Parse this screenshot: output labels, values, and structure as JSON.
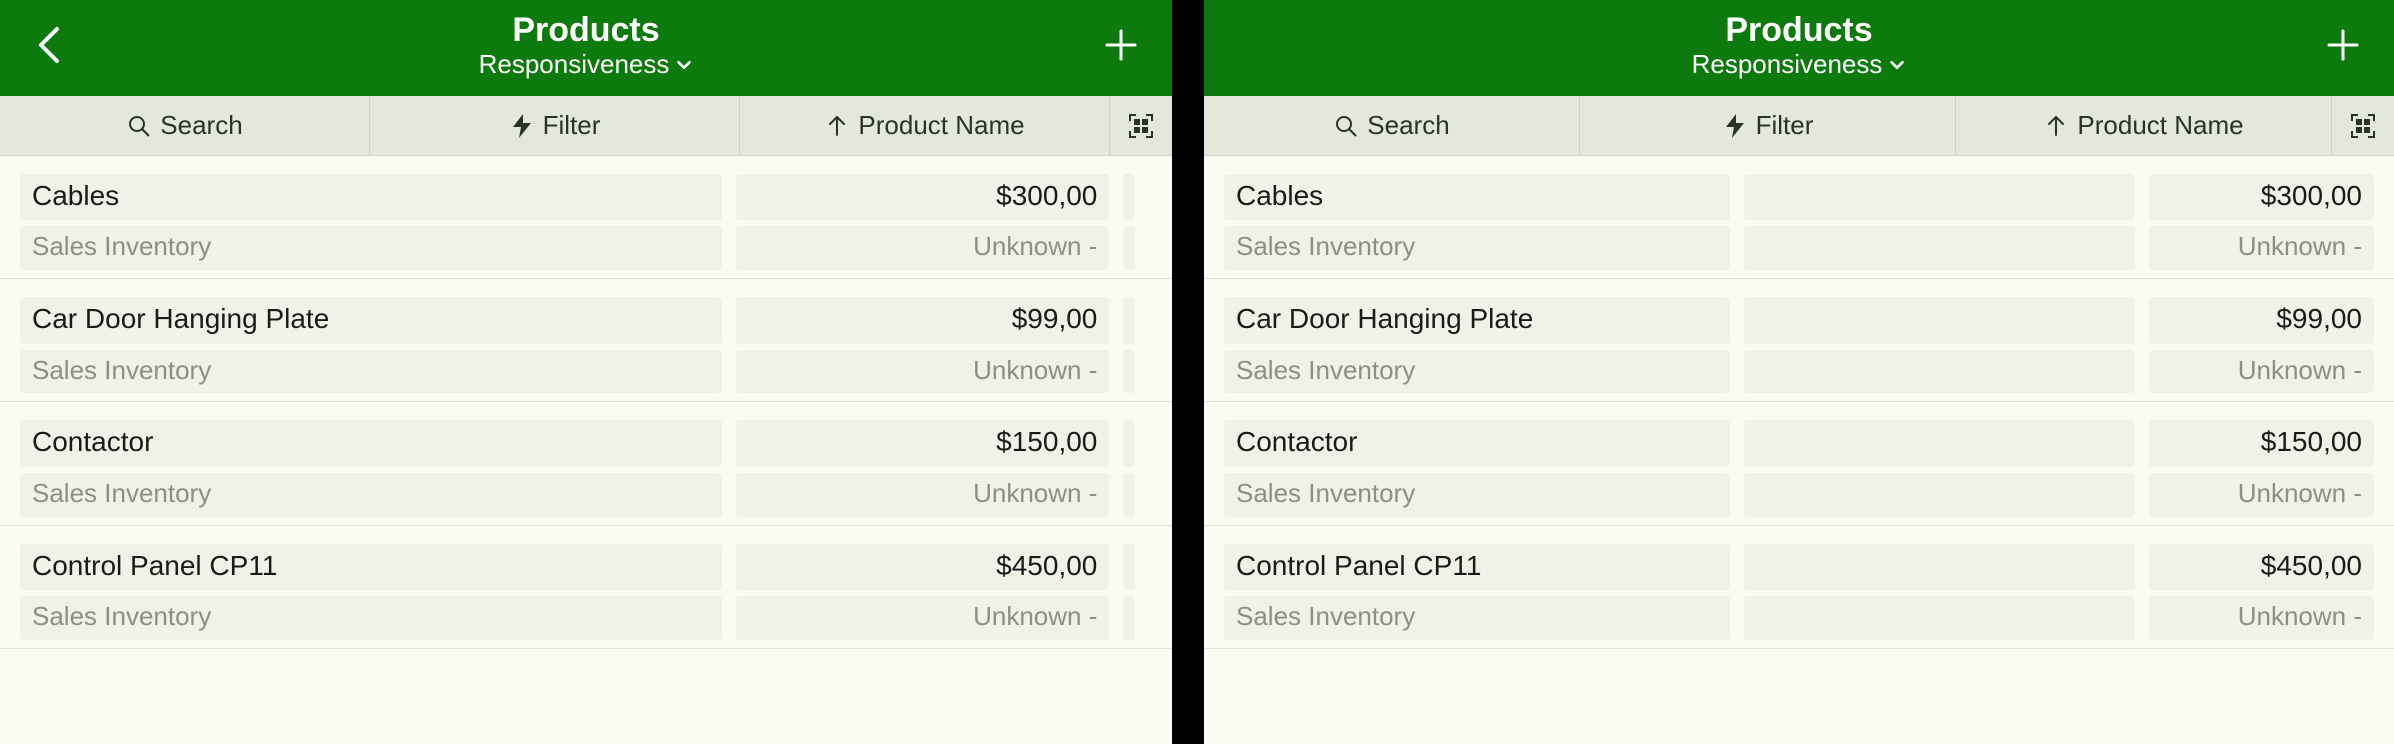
{
  "header": {
    "title": "Products",
    "subtitle": "Responsiveness"
  },
  "toolbar": {
    "search": "Search",
    "filter": "Filter",
    "sort": "Product Name"
  },
  "rows": [
    {
      "name": "Cables",
      "price": "$300,00",
      "group": "Sales Inventory",
      "status": "Unknown -"
    },
    {
      "name": "Car Door Hanging Plate",
      "price": "$99,00",
      "group": "Sales Inventory",
      "status": "Unknown -"
    },
    {
      "name": "Contactor",
      "price": "$150,00",
      "group": "Sales Inventory",
      "status": "Unknown -"
    },
    {
      "name": "Control Panel CP11",
      "price": "$450,00",
      "group": "Sales Inventory",
      "status": "Unknown -"
    }
  ]
}
